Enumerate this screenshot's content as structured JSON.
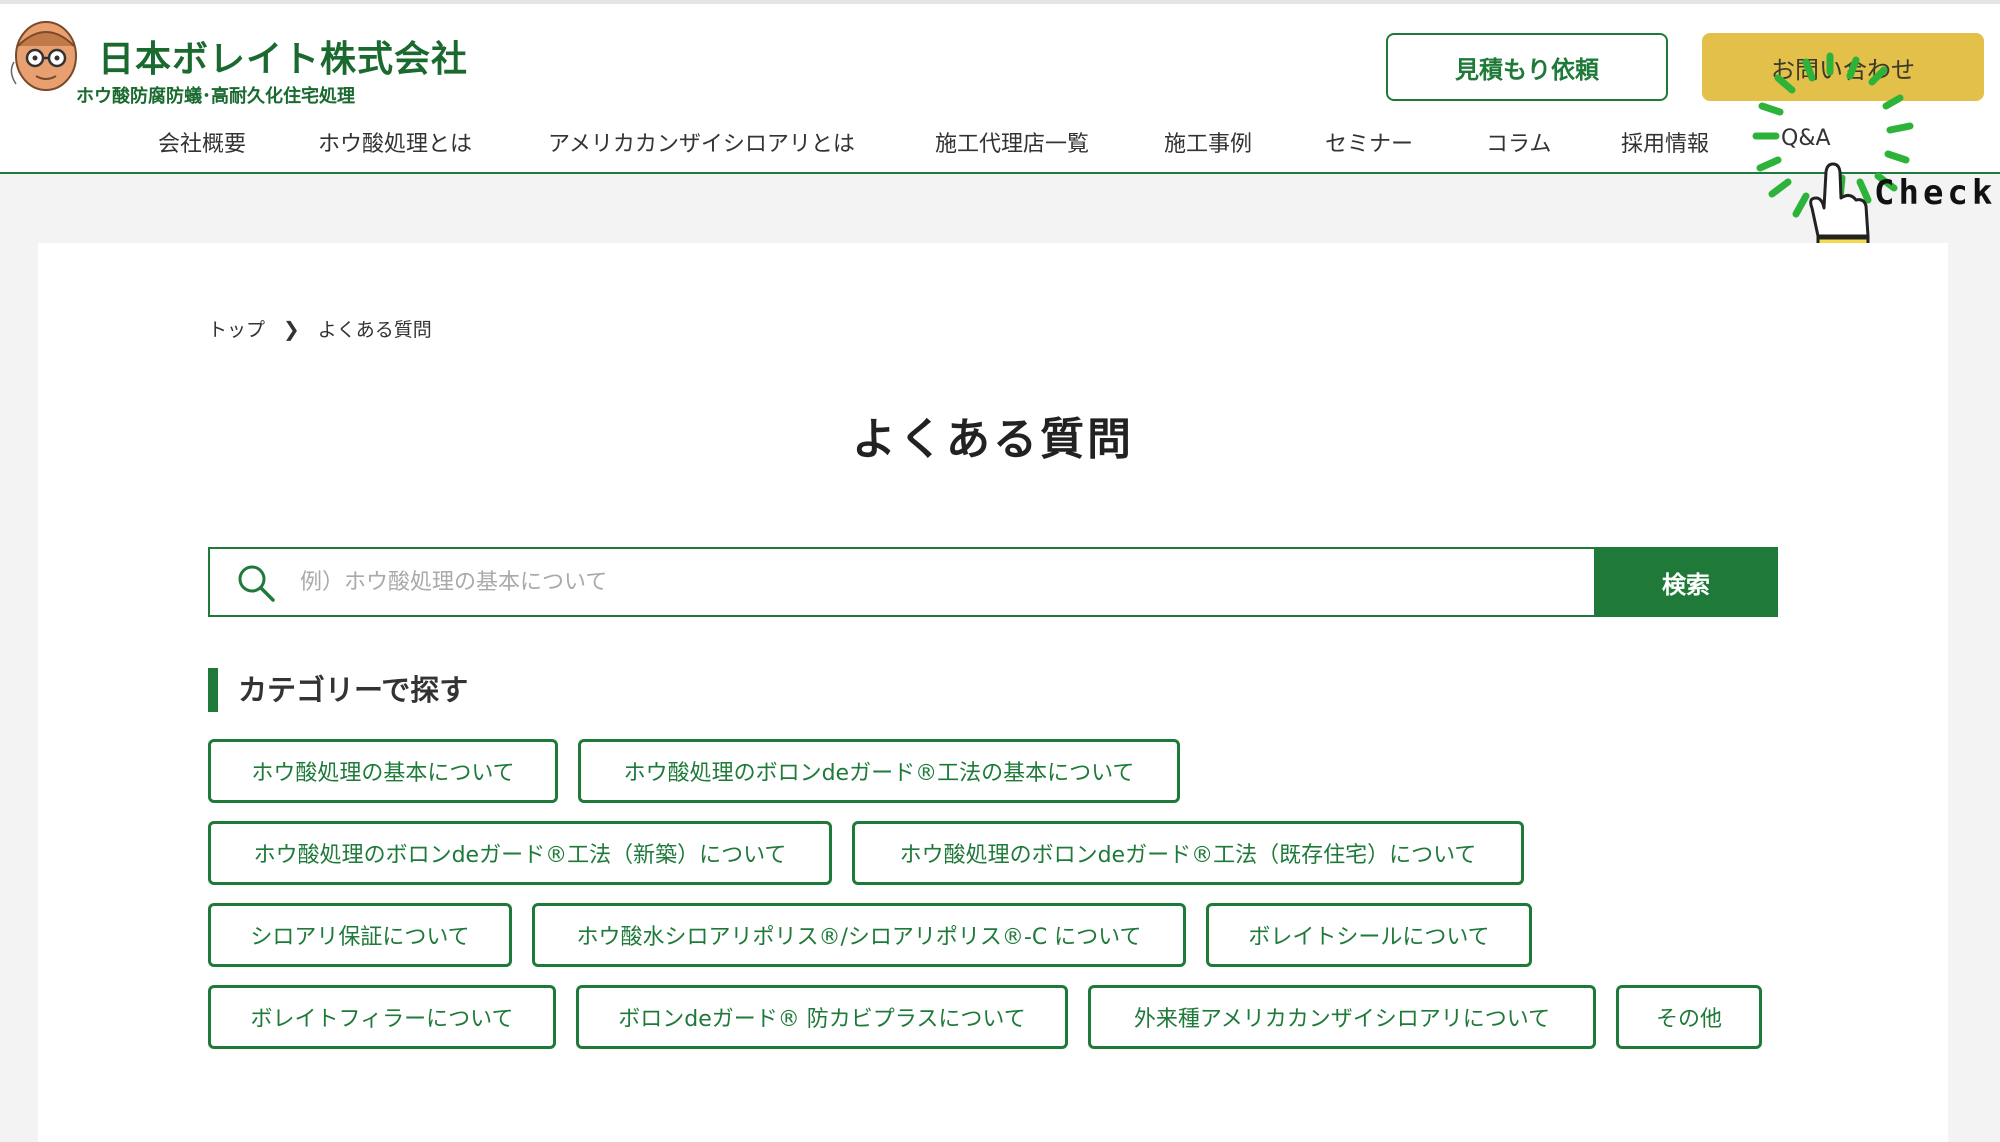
{
  "header": {
    "company_name": "日本ボレイト株式会社",
    "tagline": "ホウ酸防腐防蟻･高耐久化住宅処理",
    "estimate_button": "見積もり依頼",
    "contact_button": "お問い合わせ",
    "check_label": "Check!"
  },
  "nav": {
    "items": [
      "会社概要",
      "ホウ酸処理とは",
      "アメリカカンザイシロアリとは",
      "施工代理店一覧",
      "施工事例",
      "セミナー",
      "コラム",
      "採用情報",
      "Q&A"
    ]
  },
  "breadcrumb": {
    "home": "トップ",
    "current": "よくある質問"
  },
  "page": {
    "title": "よくある質問"
  },
  "search": {
    "placeholder": "例）ホウ酸処理の基本について",
    "value": "",
    "button": "検索"
  },
  "categories": {
    "heading": "カテゴリーで探す",
    "items": [
      "ホウ酸処理の基本について",
      "ホウ酸処理のボロンdeガード®工法の基本について",
      "ホウ酸処理のボロンdeガード®工法（新築）について",
      "ホウ酸処理のボロンdeガード®工法（既存住宅）について",
      "シロアリ保証について",
      "ホウ酸水シロアリポリス®/シロアリポリス®-C について",
      "ボレイトシールについて",
      "ボレイトフィラーについて",
      "ボロンdeガード® 防カビプラスについて",
      "外来種アメリカカンザイシロアリについて",
      "その他"
    ]
  },
  "colors": {
    "brand_green": "#1f7a3a",
    "contact_yellow": "#e3c04a",
    "check_green": "#2db33a"
  }
}
